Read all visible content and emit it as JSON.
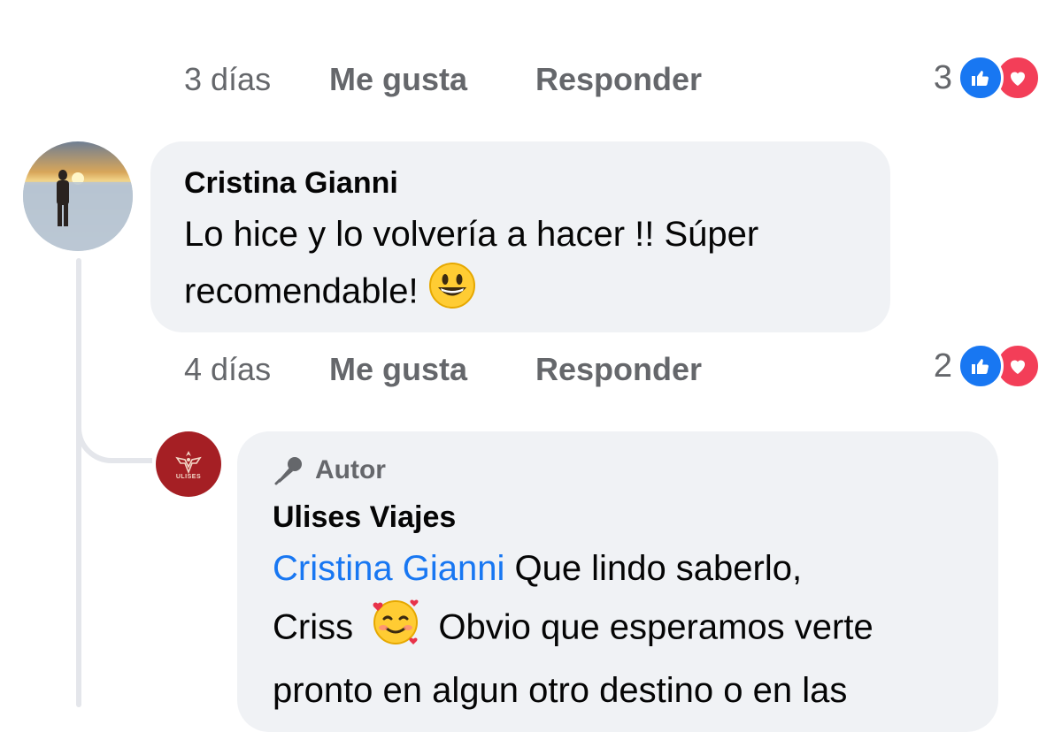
{
  "comment_top_actions": {
    "time": "3 días",
    "like": "Me gusta",
    "reply": "Responder",
    "reaction_count": "3"
  },
  "comment_cristina": {
    "author": "Cristina Gianni",
    "text": "Lo hice y lo volvería a hacer !! Súper recomendable!",
    "emoji": "grinning-face",
    "time": "4 días",
    "like": "Me gusta",
    "reply": "Responder",
    "reaction_count": "2"
  },
  "reply_ulises": {
    "badge": "Autor",
    "author": "Ulises Viajes",
    "avatar_text": "ULISES",
    "mention": "Cristina Gianni",
    "text_line1": "Que lindo saberlo,",
    "text_line2a": "Criss",
    "emoji": "smiling-face-with-hearts",
    "text_line2b": "Obvio que esperamos verte",
    "text_line3": "pronto en algun otro destino o en las"
  },
  "colors": {
    "like_blue": "#1877f2",
    "love_red": "#f33e58",
    "bubble_bg": "#f0f2f5",
    "muted_text": "#65676b",
    "brand_red": "#a51f24"
  }
}
